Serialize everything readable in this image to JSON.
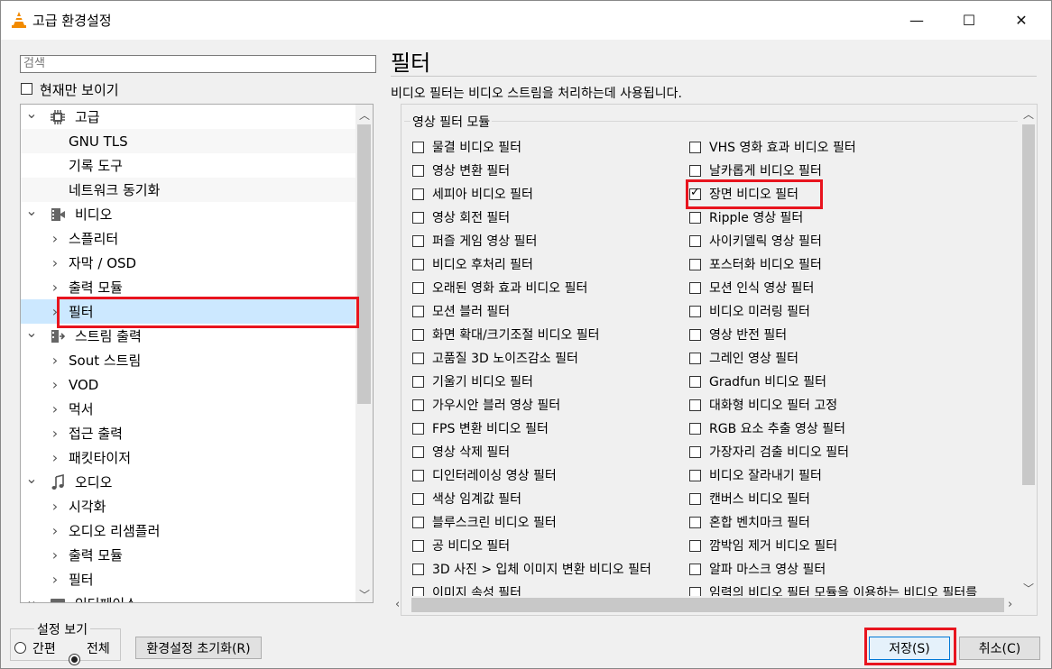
{
  "window": {
    "title": "고급 환경설정",
    "minimize": "—",
    "maximize": "☐",
    "close": "✕"
  },
  "search": {
    "placeholder": "검색"
  },
  "show_current_only": {
    "label": "현재만 보이기",
    "checked": false
  },
  "tree": [
    {
      "label": "고급",
      "level": 0,
      "expanded": true,
      "icon": "chip-icon"
    },
    {
      "label": "GNU TLS",
      "level": 1
    },
    {
      "label": "기록 도구",
      "level": 1
    },
    {
      "label": "네트워크 동기화",
      "level": 1
    },
    {
      "label": "비디오",
      "level": 0,
      "expanded": true,
      "icon": "video-icon"
    },
    {
      "label": "스플리터",
      "level": 1,
      "has_children": true
    },
    {
      "label": "자막 / OSD",
      "level": 1,
      "has_children": true
    },
    {
      "label": "출력 모듈",
      "level": 1,
      "has_children": true
    },
    {
      "label": "필터",
      "level": 1,
      "has_children": true,
      "selected": true
    },
    {
      "label": "스트림 출력",
      "level": 0,
      "expanded": true,
      "icon": "stream-output-icon"
    },
    {
      "label": "Sout 스트림",
      "level": 1,
      "has_children": true
    },
    {
      "label": "VOD",
      "level": 1,
      "has_children": true
    },
    {
      "label": "먹서",
      "level": 1,
      "has_children": true
    },
    {
      "label": "접근 출력",
      "level": 1,
      "has_children": true
    },
    {
      "label": "패킷타이저",
      "level": 1,
      "has_children": true
    },
    {
      "label": "오디오",
      "level": 0,
      "expanded": true,
      "icon": "music-note-icon"
    },
    {
      "label": "시각화",
      "level": 1,
      "has_children": true
    },
    {
      "label": "오디오 리샘플러",
      "level": 1,
      "has_children": true
    },
    {
      "label": "출력 모듈",
      "level": 1,
      "has_children": true
    },
    {
      "label": "필터",
      "level": 1,
      "has_children": true
    },
    {
      "label": "인터페이스",
      "level": 0,
      "expanded": true,
      "icon": "interface-icon"
    }
  ],
  "main": {
    "title": "필터",
    "description": "비디오 필터는 비디오 스트림을 처리하는데 사용됩니다.",
    "group_title": "영상 필터 모듈",
    "filters_left": [
      {
        "label": "물결 비디오 필터",
        "checked": false
      },
      {
        "label": "영상 변환 필터",
        "checked": false
      },
      {
        "label": "세피아 비디오 필터",
        "checked": false
      },
      {
        "label": "영상 회전 필터",
        "checked": false
      },
      {
        "label": "퍼즐 게임 영상 필터",
        "checked": false
      },
      {
        "label": "비디오 후처리 필터",
        "checked": false
      },
      {
        "label": "오래된 영화 효과 비디오 필터",
        "checked": false
      },
      {
        "label": "모션 블러 필터",
        "checked": false
      },
      {
        "label": "화면 확대/크기조절 비디오 필터",
        "checked": false
      },
      {
        "label": "고품질 3D 노이즈감소 필터",
        "checked": false
      },
      {
        "label": "기울기 비디오 필터",
        "checked": false
      },
      {
        "label": "가우시안 블러 영상 필터",
        "checked": false
      },
      {
        "label": "FPS 변환 비디오 필터",
        "checked": false
      },
      {
        "label": "영상 삭제 필터",
        "checked": false
      },
      {
        "label": "디인터레이싱 영상 필터",
        "checked": false
      },
      {
        "label": "색상 임계값 필터",
        "checked": false
      },
      {
        "label": "블루스크린 비디오 필터",
        "checked": false
      },
      {
        "label": "공 비디오 필터",
        "checked": false
      },
      {
        "label": "3D 사진 > 입체 이미지 변환 비디오 필터",
        "checked": false
      },
      {
        "label": "이미지 속성 필터",
        "checked": false
      }
    ],
    "filters_right": [
      {
        "label": "VHS 영화 효과 비디오 필터",
        "checked": false
      },
      {
        "label": "날카롭게 비디오 필터",
        "checked": false
      },
      {
        "label": "장면 비디오 필터",
        "checked": true
      },
      {
        "label": "Ripple 영상 필터",
        "checked": false
      },
      {
        "label": "사이키델릭 영상 필터",
        "checked": false
      },
      {
        "label": "포스터화 비디오 필터",
        "checked": false
      },
      {
        "label": "모션 인식 영상 필터",
        "checked": false
      },
      {
        "label": "비디오 미러링 필터",
        "checked": false
      },
      {
        "label": "영상 반전 필터",
        "checked": false
      },
      {
        "label": "그레인 영상 필터",
        "checked": false
      },
      {
        "label": "Gradfun 비디오 필터",
        "checked": false
      },
      {
        "label": "대화형 비디오 필터 고정",
        "checked": false
      },
      {
        "label": "RGB 요소 추출 영상 필터",
        "checked": false
      },
      {
        "label": "가장자리 검출 비디오 필터",
        "checked": false
      },
      {
        "label": "비디오 잘라내기 필터",
        "checked": false
      },
      {
        "label": "캔버스 비디오 필터",
        "checked": false
      },
      {
        "label": "혼합 벤치마크 필터",
        "checked": false
      },
      {
        "label": "깜박임 제거 비디오 필터",
        "checked": false
      },
      {
        "label": "알파 마스크 영상 필터",
        "checked": false
      },
      {
        "label": "임력의 비디오 필터 모듈을 이용하는 비디오 필터를",
        "checked": false
      }
    ]
  },
  "view_settings": {
    "title": "설정 보기",
    "simple": "간편",
    "all": "전체",
    "selected": "all"
  },
  "buttons": {
    "reset": "환경설정 초기화(R)",
    "save": "저장(S)",
    "cancel": "취소(C)"
  },
  "colors": {
    "highlight": "#e8141e",
    "selection": "#cce8ff",
    "accent": "#0078d7"
  }
}
